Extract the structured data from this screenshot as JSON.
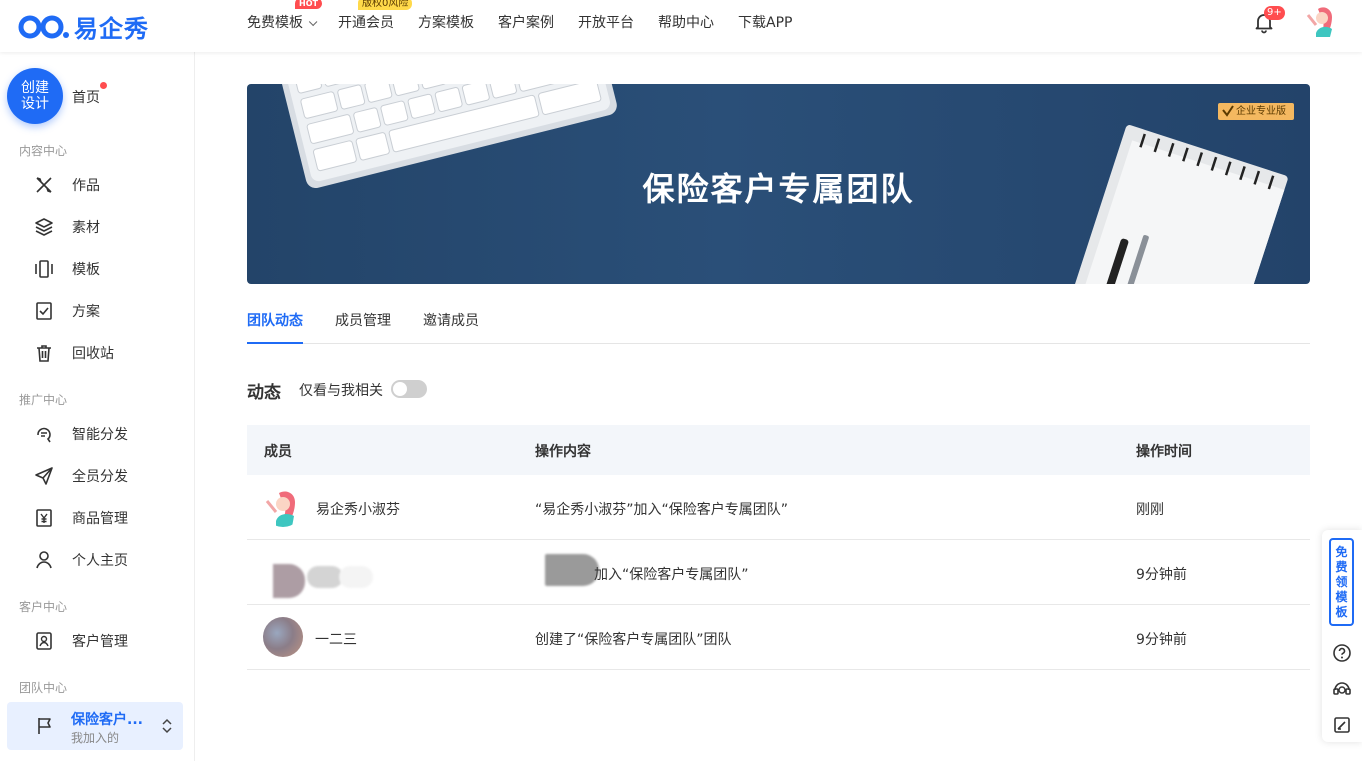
{
  "header": {
    "logo_text": "易企秀",
    "nav": [
      {
        "label": "免费模板",
        "badge": "HOT"
      },
      {
        "label": "开通会员",
        "badge": "版权0风险"
      },
      {
        "label": "方案模板"
      },
      {
        "label": "客户案例"
      },
      {
        "label": "开放平台"
      },
      {
        "label": "帮助中心"
      },
      {
        "label": "下载APP"
      }
    ],
    "notification_count": "9+"
  },
  "sidebar": {
    "create_label": "创建设计",
    "home_label": "首页",
    "sections": [
      {
        "title": "内容中心",
        "items": [
          "作品",
          "素材",
          "模板",
          "方案",
          "回收站"
        ]
      },
      {
        "title": "推广中心",
        "items": [
          "智能分发",
          "全员分发",
          "商品管理",
          "个人主页"
        ]
      },
      {
        "title": "客户中心",
        "items": [
          "客户管理"
        ]
      },
      {
        "title": "团队中心"
      }
    ],
    "team": {
      "name": "保险客户...",
      "sub": "我加入的"
    }
  },
  "banner": {
    "title": "保险客户专属团队",
    "edition": "企业专业版"
  },
  "tabs": [
    {
      "label": "团队动态",
      "active": true
    },
    {
      "label": "成员管理"
    },
    {
      "label": "邀请成员"
    }
  ],
  "activity": {
    "title": "动态",
    "filter_label": "仅看与我相关",
    "filter_on": false,
    "columns": [
      "成员",
      "操作内容",
      "操作时间"
    ],
    "rows": [
      {
        "member": "易企秀小淑芬",
        "content": "“易企秀小淑芬”加入“保险客户专属团队”",
        "time": "刚刚"
      },
      {
        "member": "",
        "content": "加入“保险客户专属团队”",
        "time": "9分钟前"
      },
      {
        "member": "一二三",
        "content": "创建了“保险客户专属团队”团队",
        "time": "9分钟前"
      }
    ]
  },
  "float_bar": {
    "free_template": "免费领模板"
  },
  "colors": {
    "brand": "#1f6bf5",
    "badge": "#ff4d4f",
    "banner": "#234469"
  }
}
